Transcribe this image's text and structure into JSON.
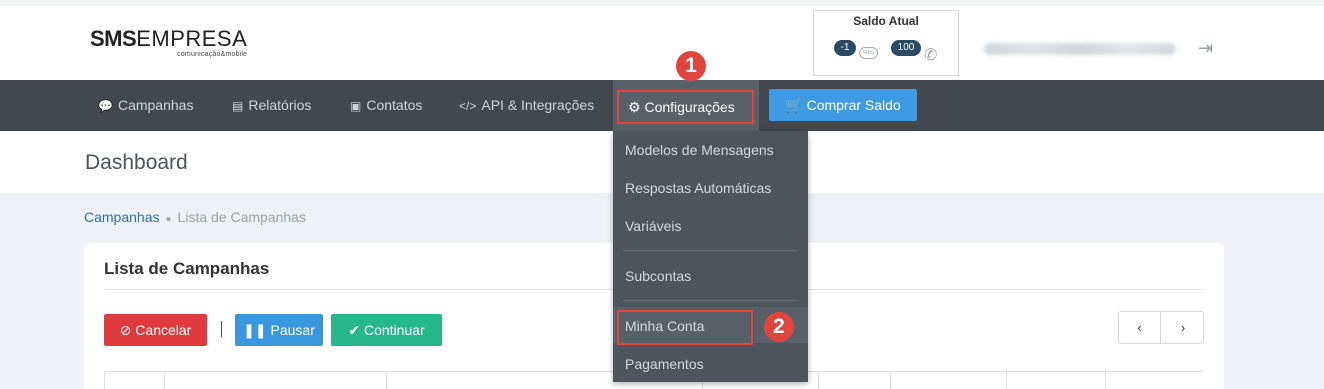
{
  "brand": {
    "logo_main_a": "SMS",
    "logo_main_b": "EMPRESA",
    "logo_sub": "comunicação&mobile"
  },
  "saldo": {
    "title": "Saldo Atual",
    "sms_value": "-1",
    "sms_icon": "sms-bubble-icon",
    "voice_value": "100",
    "voice_icon": "phone-icon"
  },
  "nav": {
    "items": [
      {
        "label": "Campanhas",
        "icon": "comments-icon"
      },
      {
        "label": "Relatórios",
        "icon": "file-icon"
      },
      {
        "label": "Contatos",
        "icon": "address-book-icon"
      },
      {
        "label": "API & Integrações",
        "icon": "code-icon"
      }
    ],
    "config_label": "Configurações",
    "comprar_label": "Comprar Saldo"
  },
  "dropdown": {
    "items": [
      "Modelos de Mensagens",
      "Respostas Automáticas",
      "Variáveis",
      "Subcontas",
      "Minha Conta",
      "Pagamentos"
    ]
  },
  "page": {
    "title": "Dashboard",
    "breadcrumb": [
      "Campanhas",
      "Lista de Campanhas"
    ],
    "card_title": "Lista de Campanhas",
    "buttons": {
      "cancel": "Cancelar",
      "pause": "Pausar",
      "continue": "Continuar"
    }
  },
  "markers": {
    "m1": "1",
    "m2": "2"
  },
  "colors": {
    "navbar": "#43484f",
    "accent_blue": "#3d9ae3",
    "danger": "#e0393e",
    "success": "#26b88a",
    "marker": "#e0453d"
  }
}
